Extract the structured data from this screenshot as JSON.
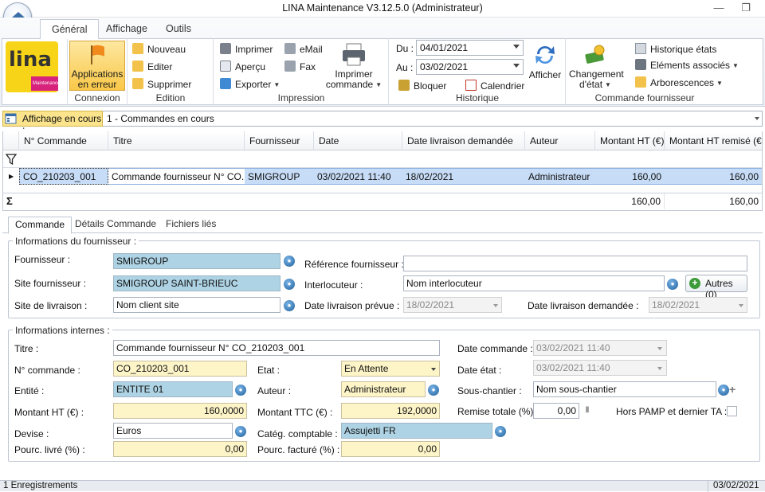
{
  "window": {
    "title": "LINA Maintenance  V3.12.5.0  (Administrateur)"
  },
  "tabs": [
    "Général",
    "Affichage",
    "Outils"
  ],
  "ribbon": {
    "logo_text": "lina",
    "logo_sub": "Maintenance",
    "connexion": {
      "apps_line1": "Applications",
      "apps_line2": "en erreur",
      "label": "Connexion"
    },
    "edition": {
      "nouveau": "Nouveau",
      "editer": "Editer",
      "supprimer": "Supprimer",
      "label": "Edition"
    },
    "impression": {
      "imprimer": "Imprimer",
      "apercu": "Aperçu",
      "exporter": "Exporter",
      "email": "eMail",
      "fax": "Fax",
      "imprimer_cmd_1": "Imprimer",
      "imprimer_cmd_2": "commande",
      "label": "Impression"
    },
    "historique": {
      "du_label": "Du :",
      "du_value": "04/01/2021",
      "au_label": "Au :",
      "au_value": "03/02/2021",
      "bloquer": "Bloquer",
      "calendrier": "Calendrier",
      "afficher": "Afficher",
      "label": "Historique"
    },
    "commande": {
      "changement_1": "Changement",
      "changement_2": "d'état",
      "historique_etats": "Historique états",
      "elements_associes": "Eléments associés",
      "arborescences": "Arborescences",
      "label": "Commande fournisseur"
    }
  },
  "affichage": {
    "label": "Affichage en cours :",
    "value": "1 - Commandes en cours"
  },
  "grid": {
    "headers": [
      "N° Commande",
      "Titre",
      "Fournisseur",
      "Date",
      "Date livraison demandée",
      "Auteur",
      "Montant HT (€)",
      "Montant HT remisé (€)"
    ],
    "row": [
      "CO_210203_001",
      "Commande fournisseur N° CO...",
      "SMIGROUP",
      "03/02/2021 11:40",
      "18/02/2021",
      "Administrateur",
      "160,00",
      "160,00"
    ],
    "totals": [
      "160,00",
      "160,00"
    ],
    "sigma": "Σ"
  },
  "subtabs": [
    "Commande",
    "Détails Commande",
    "Fichiers liés"
  ],
  "fournisseur": {
    "legend": "Informations du fournisseur :",
    "fournisseur_label": "Fournisseur :",
    "fournisseur_value": "SMIGROUP",
    "site_label": "Site fournisseur :",
    "site_value": "SMIGROUP SAINT-BRIEUC",
    "livraison_label": "Site de livraison :",
    "livraison_value": "Nom client site",
    "ref_label": "Référence fournisseur :",
    "ref_value": "",
    "interlocuteur_label": "Interlocuteur :",
    "interlocuteur_value": "Nom interlocuteur",
    "autres": "Autres (0)",
    "prevue_label": "Date livraison prévue :",
    "prevue_value": "18/02/2021",
    "demandee_label": "Date livraison demandée :",
    "demandee_value": "18/02/2021"
  },
  "internes": {
    "legend": "Informations internes :",
    "titre_label": "Titre :",
    "titre_value": "Commande fournisseur N° CO_210203_001",
    "num_label": "N° commande :",
    "num_value": "CO_210203_001",
    "entite_label": "Entité :",
    "entite_value": "ENTITE 01",
    "mht_label": "Montant HT (€) :",
    "mht_value": "160,0000",
    "devise_label": "Devise :",
    "devise_value": "Euros",
    "livre_label": "Pourc. livré (%) :",
    "livre_value": "0,00",
    "etat_label": "Etat :",
    "etat_value": "En Attente",
    "auteur_label": "Auteur :",
    "auteur_value": "Administrateur",
    "mttc_label": "Montant TTC (€) :",
    "mttc_value": "192,0000",
    "categ_label": "Catég. comptable :",
    "categ_value": "Assujetti FR",
    "facture_label": "Pourc. facturé (%) :",
    "facture_value": "0,00",
    "datecmd_label": "Date commande :",
    "datecmd_value": "03/02/2021 11:40",
    "dateetat_label": "Date état :",
    "dateetat_value": "03/02/2021 11:40",
    "souschantier_label": "Sous-chantier :",
    "souschantier_value": "Nom sous-chantier",
    "remise_label": "Remise totale (%)",
    "remise_value": "0,00",
    "pamp_label": "Hors PAMP et dernier TA :"
  },
  "status": {
    "left": "1 Enregistrements",
    "right": "03/02/2021"
  }
}
